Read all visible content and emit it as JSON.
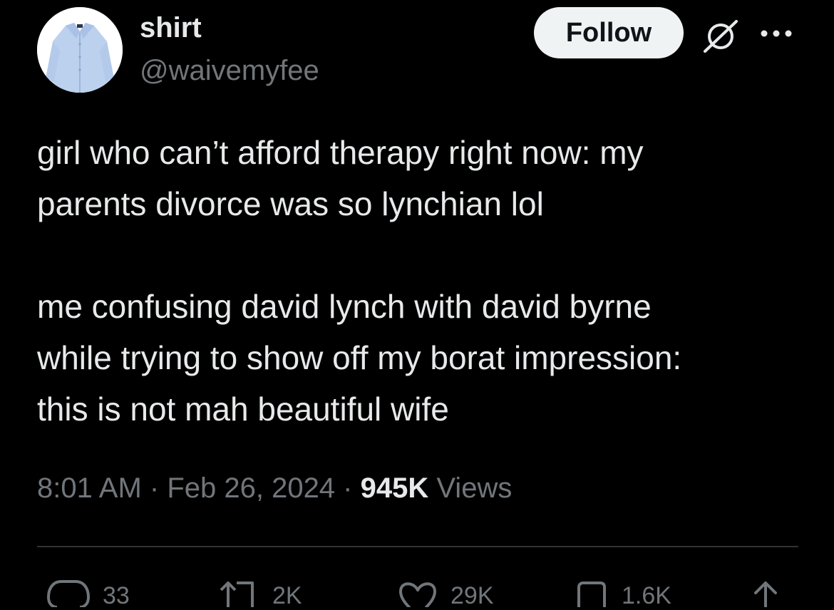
{
  "user": {
    "display_name": "shirt",
    "handle": "@waivemyfee"
  },
  "header": {
    "follow_label": "Follow",
    "grok_icon": "grok-icon",
    "more_icon": "more-icon"
  },
  "tweet": {
    "paragraphs": [
      "girl who can’t afford therapy right now: my\nparents divorce was so lynchian lol",
      "me confusing david lynch with david byrne\nwhile trying to show off my borat impression:\nthis is not mah beautiful wife"
    ]
  },
  "meta": {
    "time": "8:01 AM",
    "separator": " · ",
    "date": "Feb 26, 2024",
    "views_count": "945K",
    "views_label": " Views"
  },
  "actions": {
    "replies": "33",
    "reposts": "2K",
    "likes": "29K",
    "bookmarks": "1.6K"
  },
  "colors": {
    "background": "#000000",
    "primary_text": "#e7e9ea",
    "secondary_text": "#71767b",
    "divider": "#2f3336",
    "follow_button_bg": "#eff3f4"
  }
}
